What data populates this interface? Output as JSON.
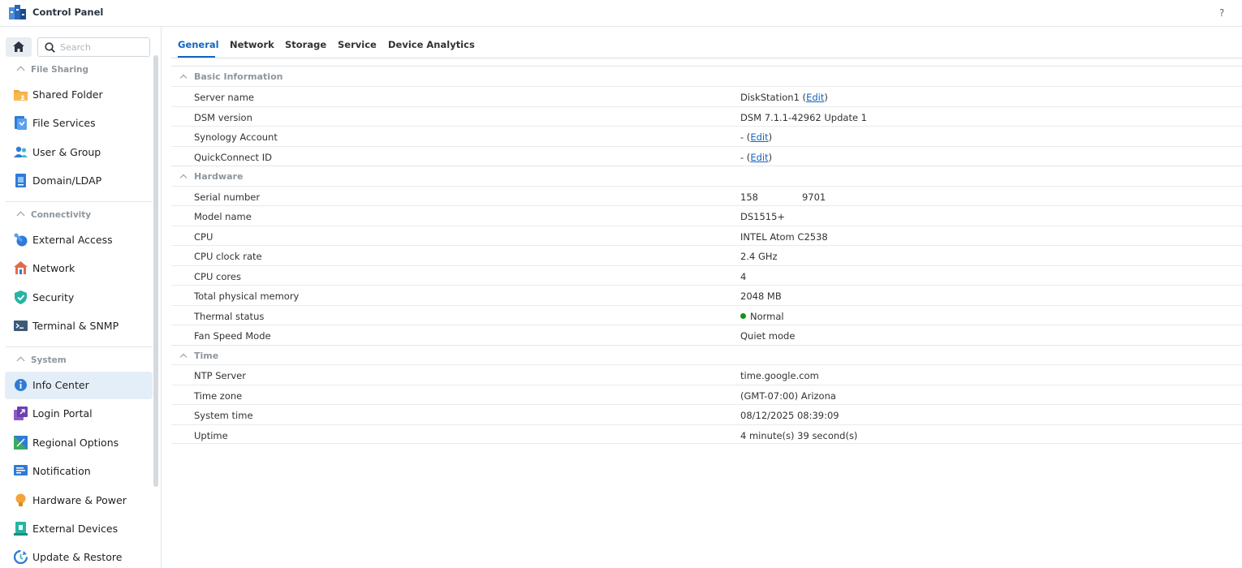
{
  "window": {
    "title": "Control Panel",
    "help_glyph": "?",
    "more_glyph": "⋮"
  },
  "sidebar": {
    "search_placeholder": "Search",
    "sections": [
      {
        "label": "File Sharing",
        "items": [
          "Shared Folder",
          "File Services",
          "User & Group",
          "Domain/LDAP"
        ]
      },
      {
        "label": "Connectivity",
        "items": [
          "External Access",
          "Network",
          "Security",
          "Terminal & SNMP"
        ]
      },
      {
        "label": "System",
        "items": [
          "Info Center",
          "Login Portal",
          "Regional Options",
          "Notification",
          "Hardware & Power",
          "External Devices",
          "Update & Restore"
        ]
      }
    ],
    "active_item": "Info Center"
  },
  "tabs": [
    "General",
    "Network",
    "Storage",
    "Service",
    "Device Analytics"
  ],
  "active_tab": "General",
  "info": {
    "basic": {
      "label": "Basic Information",
      "server_name_key": "Server name",
      "server_name": "DiskStation1",
      "edit_label": "Edit",
      "dsm_key": "DSM version",
      "dsm": "DSM 7.1.1-42962 Update 1",
      "account_key": "Synology Account",
      "account": "-",
      "qc_key": "QuickConnect ID",
      "qc": "-"
    },
    "hardware": {
      "label": "Hardware",
      "serial_key": "Serial number",
      "serial_a": "158",
      "serial_b": "9701",
      "model_key": "Model name",
      "model": "DS1515+",
      "cpu_key": "CPU",
      "cpu": "INTEL Atom C2538",
      "clock_key": "CPU clock rate",
      "clock": "2.4 GHz",
      "cores_key": "CPU cores",
      "cores": "4",
      "mem_key": "Total physical memory",
      "mem": "2048 MB",
      "thermal_key": "Thermal status",
      "thermal": "Normal",
      "fan_key": "Fan Speed Mode",
      "fan": "Quiet mode"
    },
    "time": {
      "label": "Time",
      "ntp_key": "NTP Server",
      "ntp": "time.google.com",
      "tz_key": "Time zone",
      "tz": "(GMT-07:00) Arizona",
      "systime_key": "System time",
      "systime": "08/12/2025 08:39:09",
      "uptime_key": "Uptime",
      "uptime": "4 minute(s) 39 second(s)"
    }
  },
  "colors": {
    "accent": "#1565c0",
    "active_bg": "#e4eef8",
    "status_ok": "#1a8f1a"
  }
}
